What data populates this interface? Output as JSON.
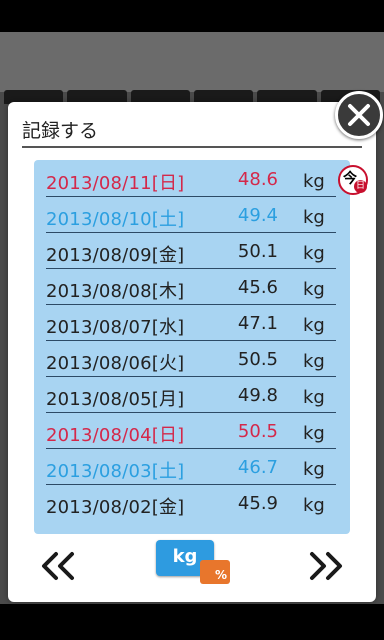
{
  "dialog": {
    "title": "記録する",
    "close_icon": "close-icon"
  },
  "today_badge": {
    "main": "今",
    "sub": "日"
  },
  "colors": {
    "sunday": "#d4284a",
    "saturday": "#2b9fe0",
    "weekday": "#222222",
    "panel": "#a8d4f2"
  },
  "records": [
    {
      "date": "2013/08/11[日]",
      "weight": "48.6",
      "unit": "kg",
      "day": "sunday"
    },
    {
      "date": "2013/08/10[土]",
      "weight": "49.4",
      "unit": "kg",
      "day": "saturday"
    },
    {
      "date": "2013/08/09[金]",
      "weight": "50.1",
      "unit": "kg",
      "day": "weekday"
    },
    {
      "date": "2013/08/08[木]",
      "weight": "45.6",
      "unit": "kg",
      "day": "weekday"
    },
    {
      "date": "2013/08/07[水]",
      "weight": "47.1",
      "unit": "kg",
      "day": "weekday"
    },
    {
      "date": "2013/08/06[火]",
      "weight": "50.5",
      "unit": "kg",
      "day": "weekday"
    },
    {
      "date": "2013/08/05[月]",
      "weight": "49.8",
      "unit": "kg",
      "day": "weekday"
    },
    {
      "date": "2013/08/04[日]",
      "weight": "50.5",
      "unit": "kg",
      "day": "sunday"
    },
    {
      "date": "2013/08/03[土]",
      "weight": "46.7",
      "unit": "kg",
      "day": "saturday"
    },
    {
      "date": "2013/08/02[金]",
      "weight": "45.9",
      "unit": "kg",
      "day": "weekday"
    }
  ],
  "footer": {
    "prev_label": "«",
    "next_label": "»",
    "unit_kg": "kg",
    "unit_pct": "%"
  }
}
